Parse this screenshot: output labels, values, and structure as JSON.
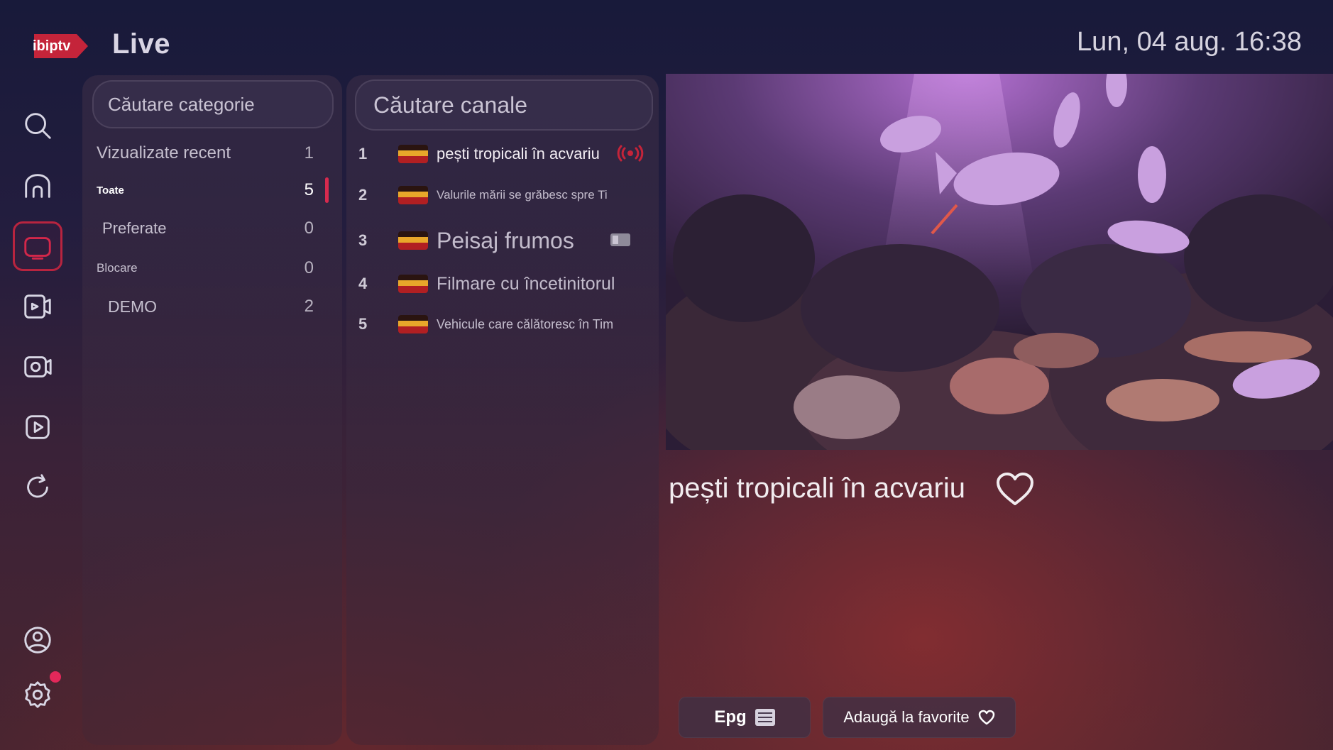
{
  "header": {
    "logo_text": "ibiptv",
    "title": "Live",
    "datetime": "Lun, 04 aug. 16:38"
  },
  "nav": {
    "items": [
      {
        "icon": "search-icon"
      },
      {
        "icon": "home-icon"
      },
      {
        "icon": "tv-icon",
        "active": true
      },
      {
        "icon": "movies-icon"
      },
      {
        "icon": "series-icon"
      },
      {
        "icon": "play-icon"
      },
      {
        "icon": "refresh-icon"
      },
      {
        "icon": "profile-icon"
      },
      {
        "icon": "settings-icon",
        "notification": true
      }
    ]
  },
  "categories": {
    "search_placeholder": "Căutare categorie",
    "items": [
      {
        "label": "Vizualizate recent",
        "count": "1"
      },
      {
        "label": "Toate",
        "count": "5",
        "active": true
      },
      {
        "label": "Preferate",
        "count": "0"
      },
      {
        "label": "Blocare",
        "count": "0"
      },
      {
        "label": "DEMO",
        "count": "2"
      }
    ]
  },
  "channels": {
    "search_placeholder": "Căutare canale",
    "items": [
      {
        "number": "1",
        "name": "pești tropicali în acvariu",
        "live": true
      },
      {
        "number": "2",
        "name": "Valurile mării se grăbesc spre Ti"
      },
      {
        "number": "3",
        "name": "Peisaj frumos"
      },
      {
        "number": "4",
        "name": "Filmare cu încetinitorul"
      },
      {
        "number": "5",
        "name": "Vehicule care călătoresc în Tim"
      }
    ]
  },
  "player": {
    "now_playing": "pești tropicali în acvariu"
  },
  "actions": {
    "epg_label": "Epg",
    "favorite_label": "Adaugă la favorite"
  },
  "colors": {
    "accent": "#d3274a",
    "flag_yellow": "#e8a72a",
    "flag_red": "#b11f22"
  }
}
